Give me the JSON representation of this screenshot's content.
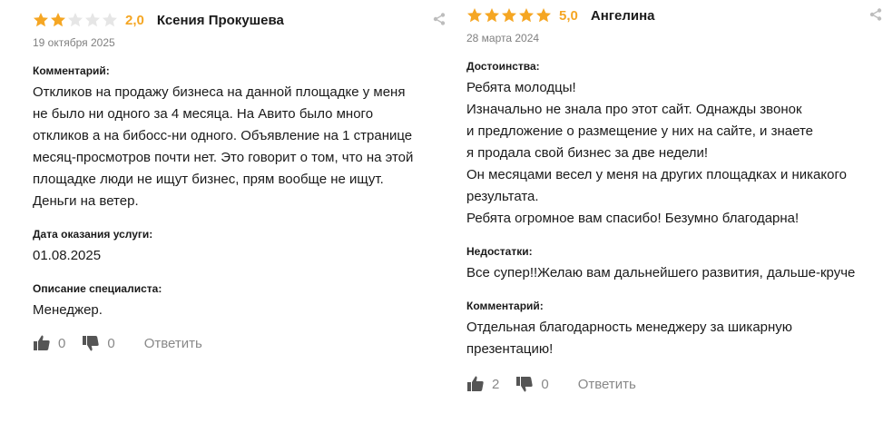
{
  "reviews": [
    {
      "rating_value": 2,
      "rating": "2,0",
      "author": "Ксения Прокушева",
      "date": "19 октября 2025",
      "sections": [
        {
          "label": "Комментарий:",
          "text": "Откликов на продажу бизнеса на данной площадке у меня\nне было ни одного за 4 месяца. На Авито было много\nоткликов а на бибосс-ни одного. Объявление на 1 странице\nмесяц-просмотров почти нет. Это говорит о том, что на этой\nплощадке люди не ищут бизнес, прям вообще не ищут.\nДеньги на ветер."
        },
        {
          "label": "Дата оказания услуги:",
          "text": "01.08.2025"
        },
        {
          "label": "Описание специалиста:",
          "text": "Менеджер."
        }
      ],
      "likes": "0",
      "dislikes": "0",
      "reply_label": "Ответить"
    },
    {
      "rating_value": 5,
      "rating": "5,0",
      "author": "Ангелина",
      "date": "28 марта 2024",
      "sections": [
        {
          "label": "Достоинства:",
          "text": "Ребята молодцы!\nИзначально не знала про этот сайт. Однажды звонок\nи предложение о размещение у них на сайте, и знаете\nя продала свой бизнес за две недели!\nОн месяцами весел у меня на других площадках и никакого\nрезультата.\nРебята огромное вам спасибо! Безумно благодарна!"
        },
        {
          "label": "Недостатки:",
          "text": "Все супер!!Желаю вам дальнейшего развития, дальше-круче"
        },
        {
          "label": "Комментарий:",
          "text": "Отдельная благодарность менеджеру за шикарную\nпрезентацию!"
        }
      ],
      "likes": "2",
      "dislikes": "0",
      "reply_label": "Ответить"
    }
  ],
  "colors": {
    "star_filled": "#F5A623",
    "star_empty": "#E6E6E6",
    "rating_text": "#F5A623",
    "muted": "#808080",
    "icon": "#555555"
  },
  "icons": {
    "star": "star-icon",
    "share": "share-icon",
    "like": "thumbs-up-icon",
    "dislike": "thumbs-down-icon"
  }
}
